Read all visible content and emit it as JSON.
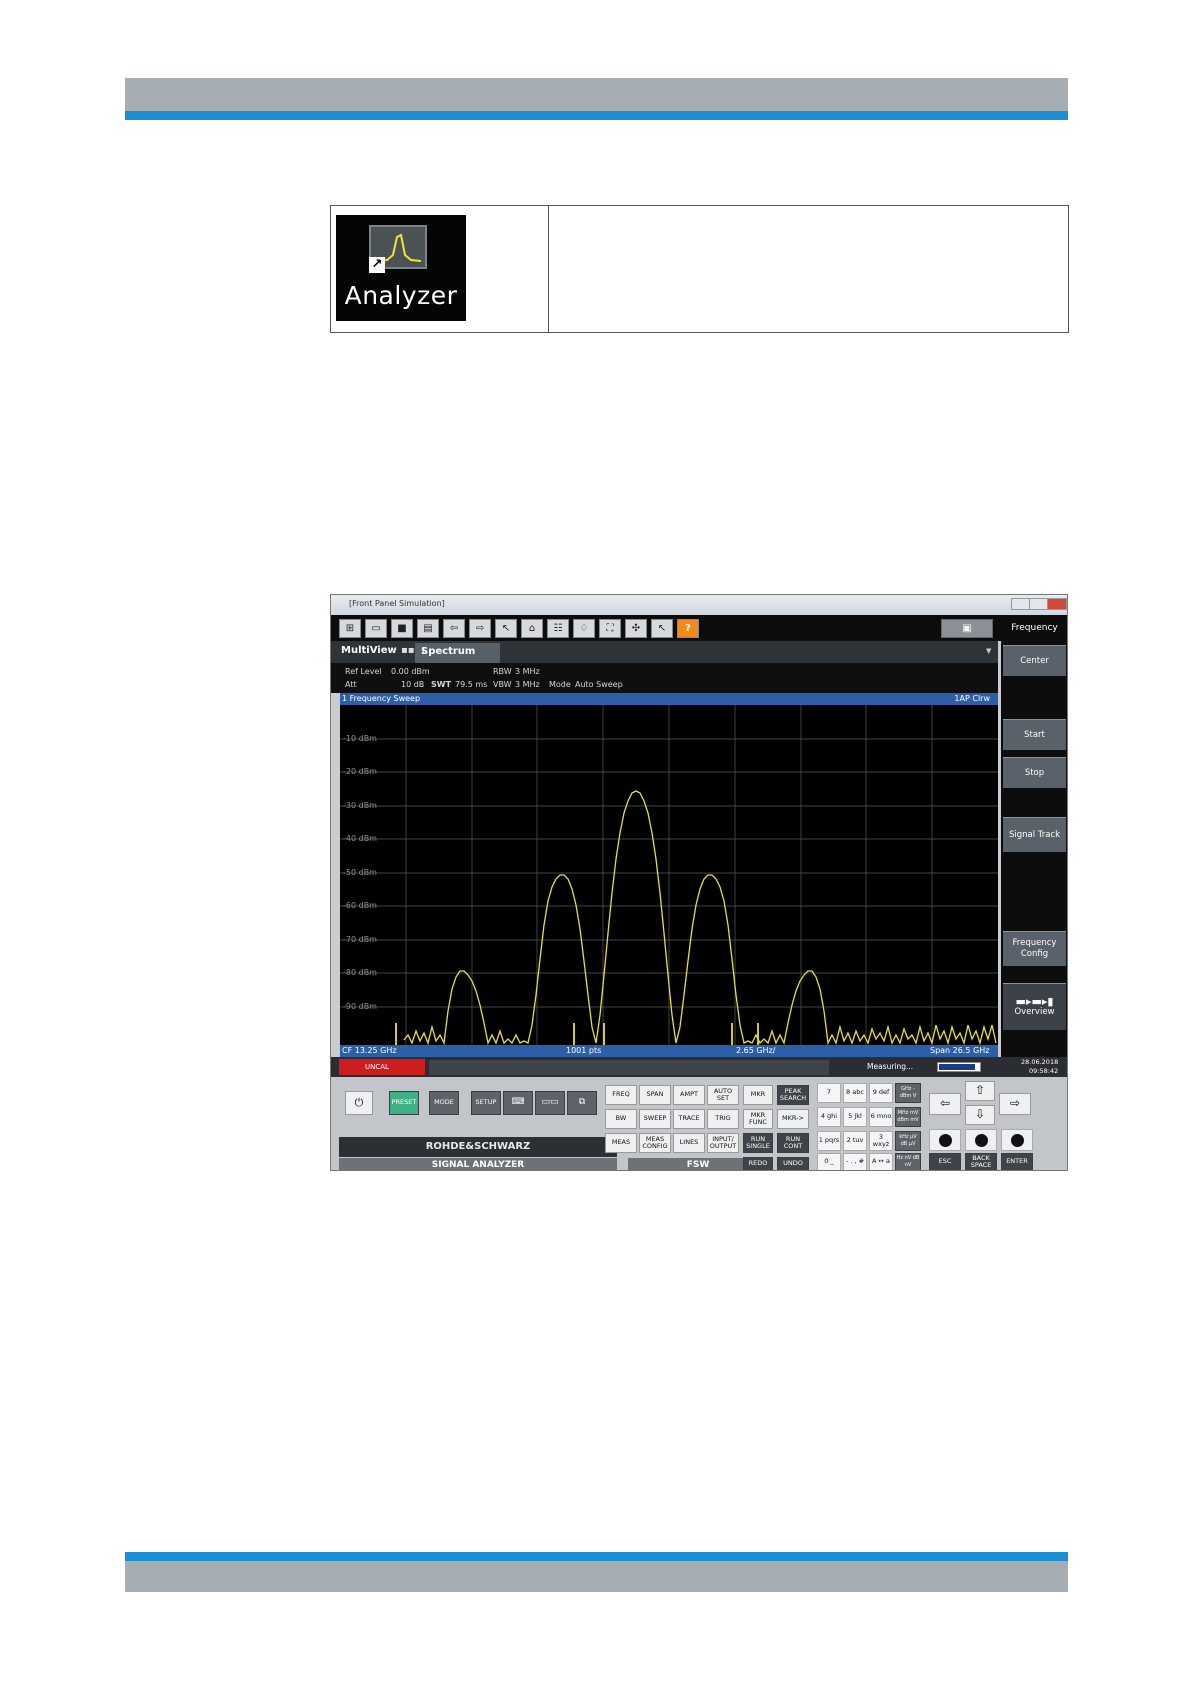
{
  "icon_table": {
    "shortcut_label": "Analyzer",
    "shortcut_arrow": "↗"
  },
  "app": {
    "title": "[Front Panel Simulation]",
    "toolbar_help": "?",
    "toolbar_icons": [
      "windows-icon",
      "open-icon",
      "save-icon",
      "print-icon",
      "undo-icon",
      "redo-icon",
      "pointer-icon",
      "marker-icon",
      "table-icon",
      "marker-search-icon",
      "zoom-icon",
      "measure-icon",
      "help-pointer-icon"
    ],
    "tabs": {
      "multiview": "MultiView",
      "spectrum": "Spectrum",
      "warning": "!"
    },
    "info": {
      "ref_level_label": "Ref Level",
      "ref_level_value": "0.00 dBm",
      "att_label": "Att",
      "att_value": "10 dB",
      "swt_label": "SWT",
      "swt_value": "79.5 ms",
      "rbw_label": "RBW",
      "rbw_value": "3 MHz",
      "vbw_label": "VBW",
      "vbw_value": "3 MHz",
      "mode_label": "Mode",
      "mode_value": "Auto Sweep"
    },
    "diagram": {
      "title": "1 Frequency Sweep",
      "trace_label": "1AP Clrw",
      "ylabels": [
        "-10 dBm",
        "-20 dBm",
        "-30 dBm",
        "-40 dBm",
        "-50 dBm",
        "-60 dBm",
        "-70 dBm",
        "-80 dBm",
        "-90 dBm"
      ],
      "footer_cf": "CF 13.25 GHz",
      "footer_pts": "1001 pts",
      "footer_div": "2.65 GHz/",
      "footer_span": "Span 26.5 GHz"
    },
    "softkeys": {
      "title": "Frequency",
      "center": "Center",
      "start": "Start",
      "stop": "Stop",
      "signal_track": "Signal Track",
      "freq_config": "Frequency Config",
      "overview": "Overview"
    },
    "status": {
      "uncal": "UNCAL",
      "measuring": "Measuring...",
      "date": "28.06.2018",
      "time": "09:58:42",
      "progress": 0.9
    },
    "front_panel": {
      "preset": "PRESET",
      "mode": "MODE",
      "setup": "SETUP",
      "freq": "FREQ",
      "span": "SPAN",
      "ampt": "AMPT",
      "auto_set": "AUTO SET",
      "bw": "BW",
      "sweep": "SWEEP",
      "trace": "TRACE",
      "trig": "TRIG",
      "meas": "MEAS",
      "meas_config": "MEAS CONFIG",
      "lines": "LINES",
      "input_output": "INPUT/ OUTPUT",
      "mkr": "MKR",
      "peak_search": "PEAK SEARCH",
      "mkr_func": "MKR FUNC",
      "mkr_to": "MKR->",
      "run_single": "RUN SINGLE",
      "run_cont": "RUN CONT",
      "redo": "REDO",
      "undo": "UNDO",
      "keys": [
        "7",
        "8 abc",
        "9 def",
        "4 ghi",
        "5 jkl",
        "6 mno",
        "1 pqrs",
        "2 tuv",
        "3 wxyz",
        "0 _",
        "- . , #",
        "A ↔ a"
      ],
      "unit_keys": [
        "GHz -dBm V",
        "MHz mV dBm mV",
        "kHz µV dB µV",
        "Hz nV dB nV"
      ],
      "esc": "ESC",
      "backspace": "BACK SPACE",
      "enter": "ENTER",
      "brand": "ROHDE&SCHWARZ",
      "product": "SIGNAL ANALYZER",
      "model": "FSW"
    }
  }
}
